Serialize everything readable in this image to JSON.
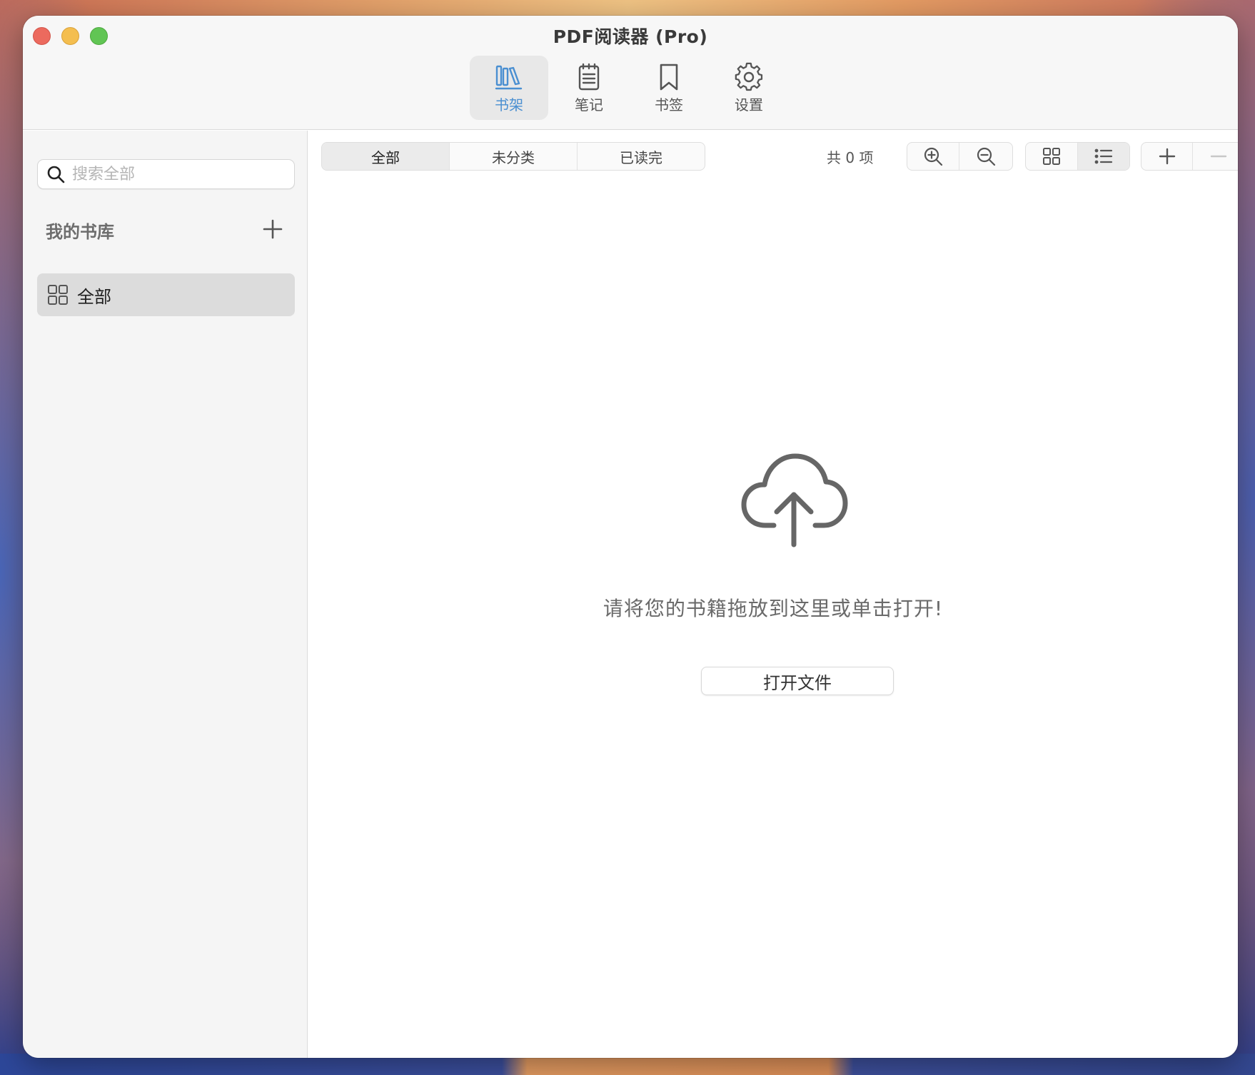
{
  "window": {
    "title": "PDF阅读器 (Pro)"
  },
  "toolbar": {
    "tabs": [
      {
        "label": "书架",
        "icon": "bookshelf-icon",
        "active": true
      },
      {
        "label": "笔记",
        "icon": "notes-icon"
      },
      {
        "label": "书签",
        "icon": "bookmark-icon"
      },
      {
        "label": "设置",
        "icon": "gear-icon"
      }
    ]
  },
  "sidebar": {
    "search_placeholder": "搜索全部",
    "section_title": "我的书库",
    "items": [
      {
        "label": "全部",
        "icon": "grid-icon",
        "selected": true
      }
    ]
  },
  "main": {
    "filters": [
      {
        "label": "全部",
        "active": true
      },
      {
        "label": "未分类"
      },
      {
        "label": "已读完"
      }
    ],
    "count_text": "共 0 项",
    "empty_message": "请将您的书籍拖放到这里或单击打开!",
    "open_button": "打开文件"
  },
  "colors": {
    "accent": "#4a8fd1",
    "sidebar_bg": "#f5f5f5",
    "selected_bg": "#dcdcdc"
  }
}
